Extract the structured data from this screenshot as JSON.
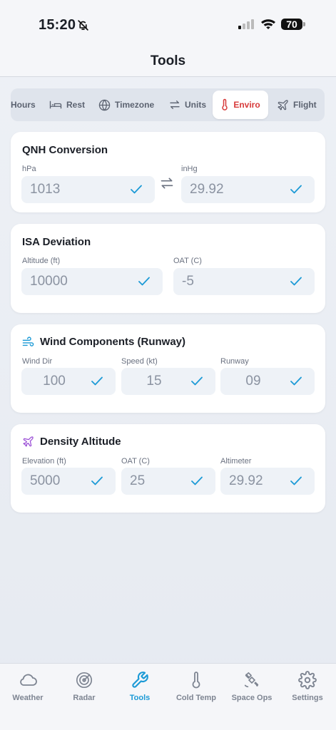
{
  "status": {
    "time": "15:20",
    "battery": "70"
  },
  "header": {
    "title": "Tools"
  },
  "tabs": [
    {
      "label": "Hours",
      "icon": "none"
    },
    {
      "label": "Rest",
      "icon": "bed-icon"
    },
    {
      "label": "Timezone",
      "icon": "globe-icon"
    },
    {
      "label": "Units",
      "icon": "swap-icon"
    },
    {
      "label": "Enviro",
      "icon": "thermometer-icon",
      "active": true
    },
    {
      "label": "Flight",
      "icon": "plane-icon"
    }
  ],
  "qnh": {
    "title": "QNH Conversion",
    "hpa_label": "hPa",
    "hpa_value": "1013",
    "inhg_label": "inHg",
    "inhg_value": "29.92"
  },
  "isa": {
    "title": "ISA Deviation",
    "alt_label": "Altitude (ft)",
    "alt_value": "10000",
    "oat_label": "OAT (C)",
    "oat_value": "-5"
  },
  "wind": {
    "title": "Wind Components (Runway)",
    "dir_label": "Wind Dir",
    "dir_value": "100",
    "speed_label": "Speed (kt)",
    "speed_value": "15",
    "runway_label": "Runway",
    "runway_value": "09"
  },
  "density": {
    "title": "Density Altitude",
    "elev_label": "Elevation (ft)",
    "elev_value": "5000",
    "oat_label": "OAT (C)",
    "oat_value": "25",
    "alt_label": "Altimeter",
    "alt_value": "29.92"
  },
  "nav": [
    {
      "label": "Weather",
      "icon": "cloud-icon"
    },
    {
      "label": "Radar",
      "icon": "radar-icon"
    },
    {
      "label": "Tools",
      "icon": "wrench-icon",
      "active": true
    },
    {
      "label": "Cold Temp",
      "icon": "thermometer-icon"
    },
    {
      "label": "Space Ops",
      "icon": "satellite-icon"
    },
    {
      "label": "Settings",
      "icon": "gear-icon"
    }
  ],
  "colors": {
    "accent": "#1c9ad6",
    "active_tab": "#d73a3a",
    "wind_icon": "#1c9ad6",
    "density_icon": "#9b4fd6"
  }
}
